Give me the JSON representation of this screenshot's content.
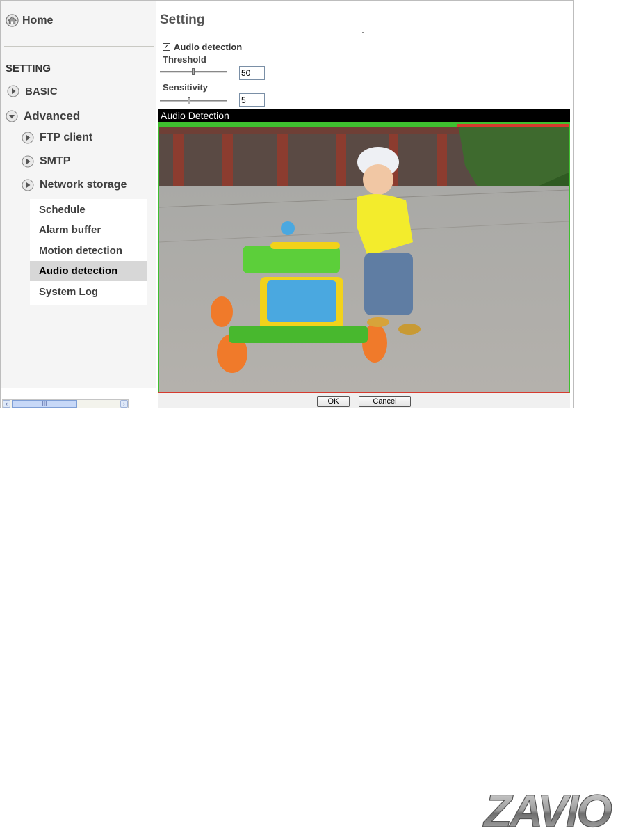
{
  "sidebar": {
    "home_label": "Home",
    "section_title": "SETTING",
    "basic_label": "BASIC",
    "advanced_label": "Advanced",
    "items": [
      {
        "label": "FTP client"
      },
      {
        "label": "SMTP"
      },
      {
        "label": "Network storage"
      }
    ],
    "subitems": [
      {
        "label": "Schedule",
        "active": false
      },
      {
        "label": "Alarm buffer",
        "active": false
      },
      {
        "label": "Motion detection",
        "active": false
      },
      {
        "label": "Audio detection",
        "active": true
      },
      {
        "label": "System Log",
        "active": false
      }
    ],
    "scrollbar_grip": "III"
  },
  "main": {
    "title": "Setting",
    "audio_detection_label": "Audio detection",
    "audio_detection_checked": true,
    "threshold_label": "Threshold",
    "threshold_value": "50",
    "sensitivity_label": "Sensitivity",
    "sensitivity_value": "5",
    "video_title": "Audio Detection",
    "ok_label": "OK",
    "cancel_label": "Cancel"
  },
  "brand": {
    "logo_text": "ZAVIO"
  },
  "colors": {
    "active_bg": "#d7d7d7",
    "video_border_green": "#3fbf2f",
    "video_border_red": "#d63a2e",
    "video_header_bg": "#000000"
  },
  "icons": [
    "home-icon",
    "arrow-right-icon",
    "arrow-down-icon",
    "check-icon",
    "chevron-left-icon",
    "chevron-right-icon"
  ]
}
